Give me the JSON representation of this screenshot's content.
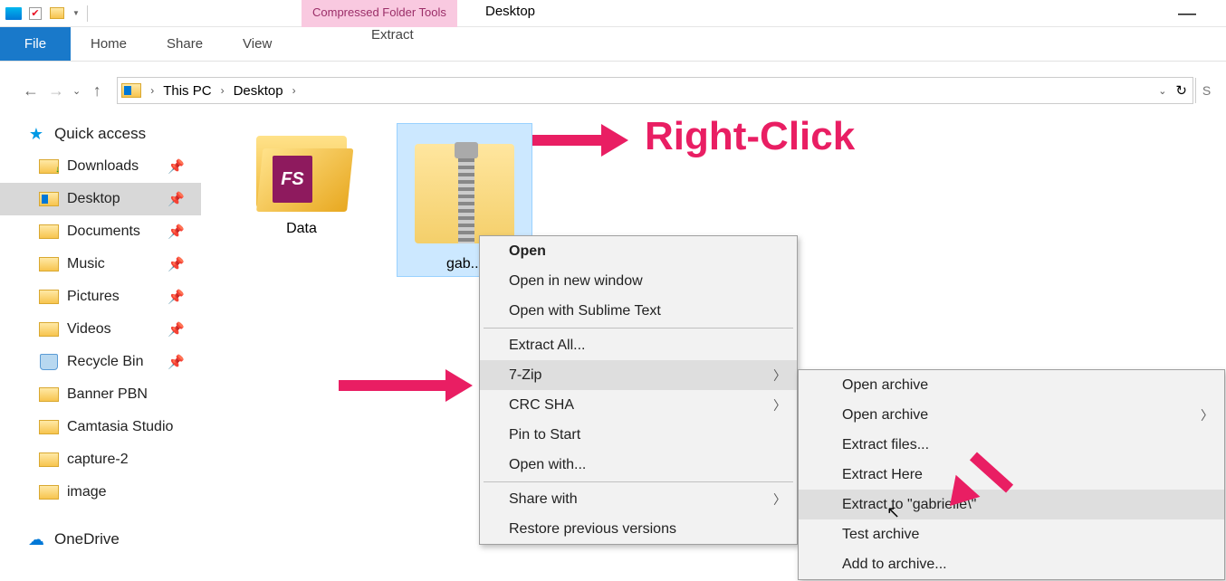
{
  "titlebar": {
    "contextual_tab": "Compressed Folder Tools",
    "window_title": "Desktop"
  },
  "ribbon": {
    "file": "File",
    "tabs": [
      "Home",
      "Share",
      "View"
    ],
    "extract": "Extract"
  },
  "breadcrumb": {
    "seg1": "This PC",
    "seg2": "Desktop"
  },
  "sidebar": {
    "quick_access": "Quick access",
    "items": [
      {
        "label": "Downloads",
        "pinned": true
      },
      {
        "label": "Desktop",
        "pinned": true,
        "selected": true
      },
      {
        "label": "Documents",
        "pinned": true
      },
      {
        "label": "Music",
        "pinned": true
      },
      {
        "label": "Pictures",
        "pinned": true
      },
      {
        "label": "Videos",
        "pinned": true
      },
      {
        "label": "Recycle Bin",
        "pinned": true
      },
      {
        "label": "Banner PBN"
      },
      {
        "label": "Camtasia Studio"
      },
      {
        "label": "capture-2"
      },
      {
        "label": "image"
      }
    ],
    "onedrive": "OneDrive"
  },
  "content": {
    "items": [
      {
        "label": "Data"
      },
      {
        "label": "gab...",
        "selected": true
      }
    ]
  },
  "context1": {
    "open": "Open",
    "open_new": "Open in new window",
    "open_sublime": "Open with Sublime Text",
    "extract_all": "Extract All...",
    "seven_zip": "7-Zip",
    "crc": "CRC SHA",
    "pin": "Pin to Start",
    "open_with": "Open with...",
    "share": "Share with",
    "restore": "Restore previous versions"
  },
  "context2": {
    "open_archive1": "Open archive",
    "open_archive2": "Open archive",
    "extract_files": "Extract files...",
    "extract_here": "Extract Here",
    "extract_to": "Extract to \"gabrielle\\\"",
    "test": "Test archive",
    "add": "Add to archive..."
  },
  "annotation": {
    "right_click": "Right-Click"
  }
}
